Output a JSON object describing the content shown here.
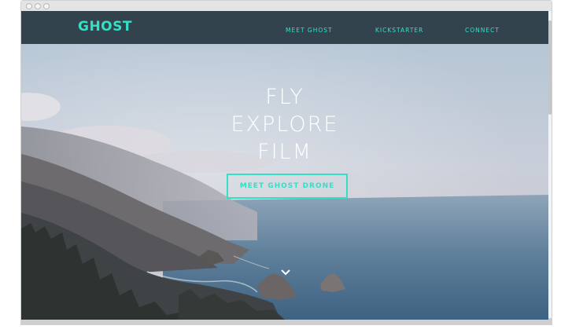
{
  "nav": {
    "logo": "GHOST",
    "links": [
      "MEET GHOST",
      "KICKSTARTER",
      "CONNECT"
    ]
  },
  "hero": {
    "headline": [
      "FLY",
      "EXPLORE",
      "FILM"
    ],
    "cta_label": "MEET GHOST DRONE",
    "scroll_icon": "chevron-down-icon"
  },
  "colors": {
    "accent": "#33e0c6",
    "navbar": "#33434d"
  }
}
